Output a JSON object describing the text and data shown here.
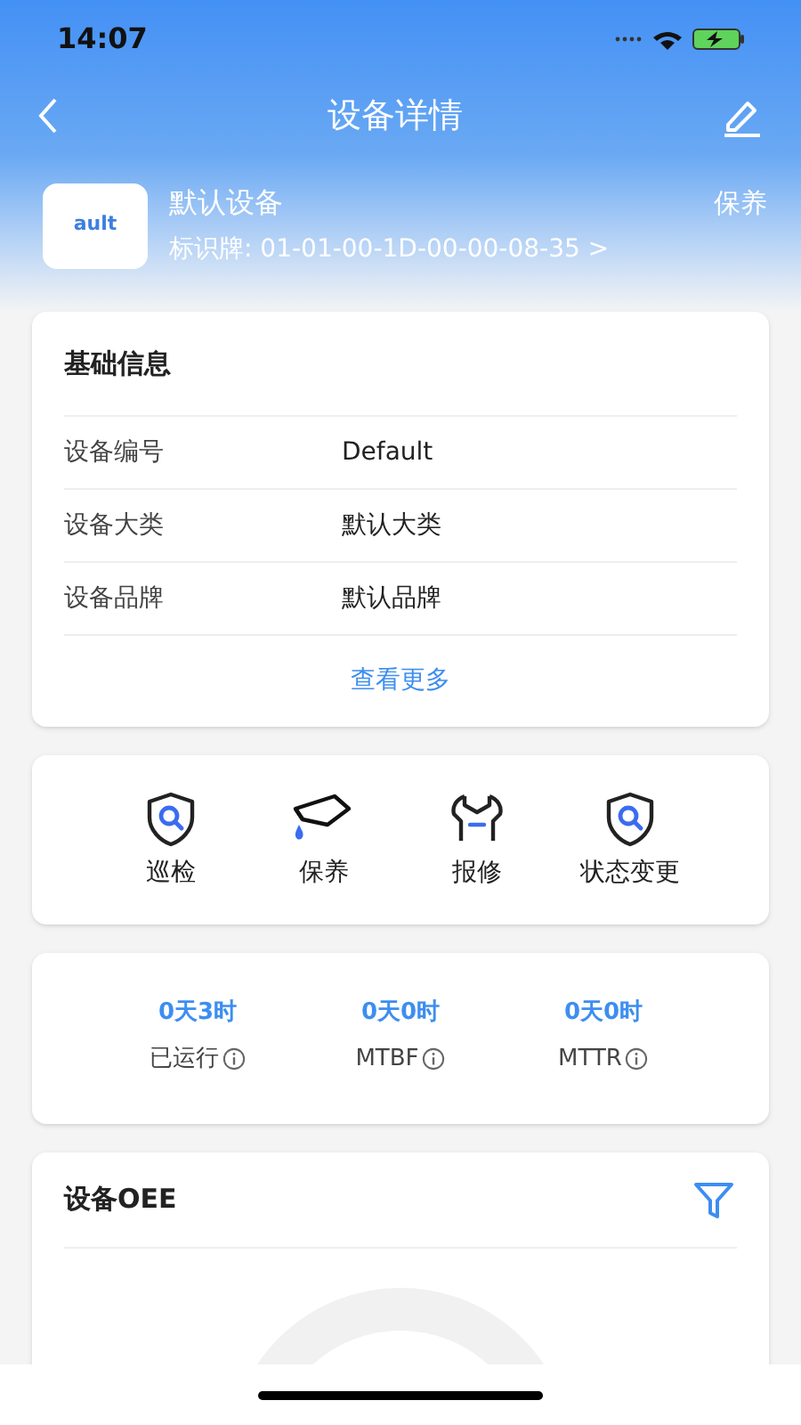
{
  "status_bar": {
    "time": "14:07"
  },
  "nav": {
    "title": "设备详情"
  },
  "device": {
    "logo_text": "ault",
    "name": "默认设备",
    "status": "保养",
    "tag": "标识牌: 01-01-00-1D-00-00-08-35 >"
  },
  "basic_info": {
    "title": "基础信息",
    "rows": [
      {
        "label": "设备编号",
        "value": "Default"
      },
      {
        "label": "设备大类",
        "value": "默认大类"
      },
      {
        "label": "设备品牌",
        "value": "默认品牌"
      }
    ],
    "more_link": "查看更多"
  },
  "actions": [
    {
      "kind": "inspect",
      "label": "巡检"
    },
    {
      "kind": "maintain",
      "label": "保养"
    },
    {
      "kind": "repair",
      "label": "报修"
    },
    {
      "kind": "status",
      "label": "状态变更"
    }
  ],
  "metrics": [
    {
      "value": "0天3时",
      "label": "已运行"
    },
    {
      "value": "0天0时",
      "label": "MTBF"
    },
    {
      "value": "0天0时",
      "label": "MTTR"
    }
  ],
  "oee": {
    "title": "设备OEE"
  }
}
